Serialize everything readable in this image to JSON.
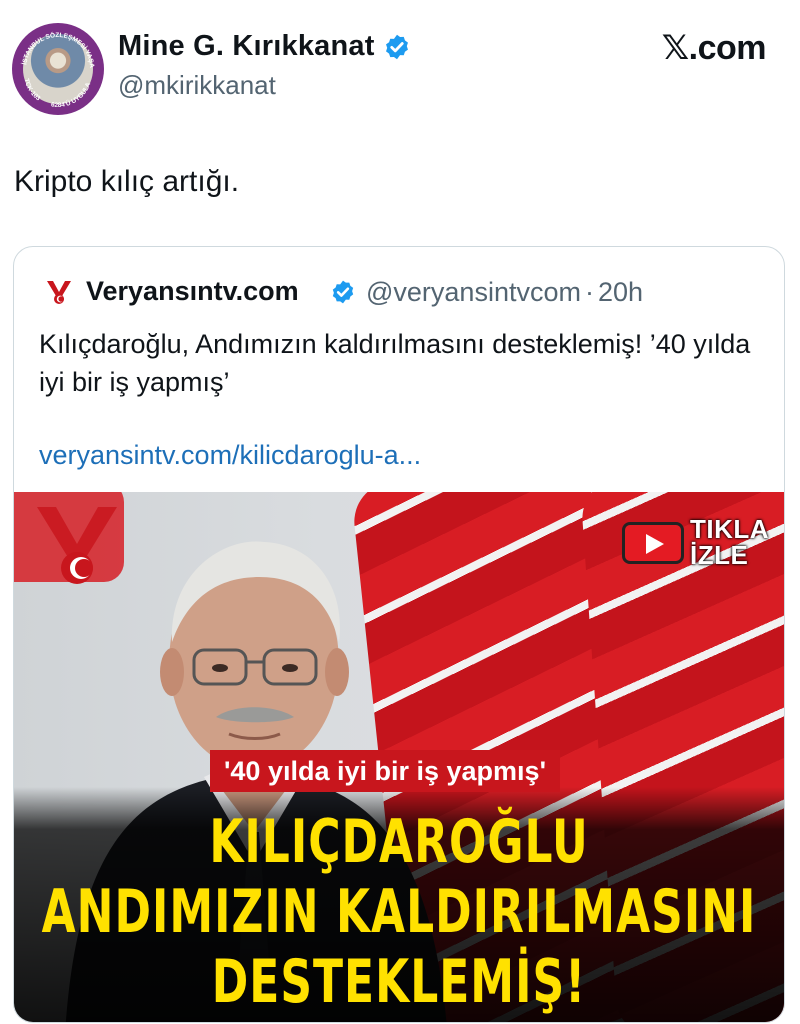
{
  "author": {
    "display_name": "Mine G. Kırıkkanat",
    "handle": "@mkirikkanat",
    "avatar_ring_text_top": "İSTANBUL SÖZLEŞMESİ YAŞATIR",
    "avatar_ring_text_left": "TCK-103",
    "avatar_ring_text_bottom": "6284'Ü UYGULA"
  },
  "site": {
    "label": "𝕏.com"
  },
  "tweet": {
    "text": "Kripto kılıç artığı."
  },
  "quote": {
    "display_name": "Veryansıntv.com",
    "handle": "@veryansintvcom",
    "separator": "·",
    "time": "20h",
    "text": "Kılıçdaroğlu, Andımızın kaldırılmasını desteklemiş! ’40 yılda iyi bir iş yapmış’",
    "link": "veryansintv.com/kilicdaroglu-a..."
  },
  "media": {
    "badge_line1": "TIKLA",
    "badge_line2": "İZLE",
    "quote_banner": "'40 yılda iyi bir iş yapmış'",
    "headline_1": "KILIÇDAROĞLU",
    "headline_2": "ANDIMIZIN KALDIRILMASINI",
    "headline_3": "DESTEKLEMİŞ!"
  },
  "colors": {
    "verified_blue": "#1d9bf0",
    "link_blue": "#1d6fb8",
    "headline_yellow": "#ffe100",
    "flag_red": "#d81d24"
  }
}
